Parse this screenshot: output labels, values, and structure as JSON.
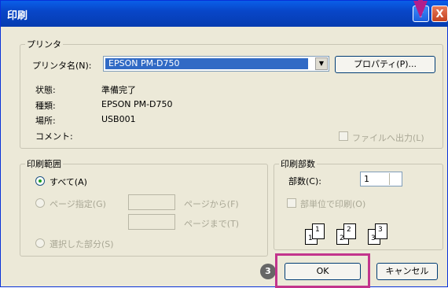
{
  "window": {
    "title": "印刷",
    "help": "?",
    "close": "X"
  },
  "printer": {
    "group_label": "プリンタ",
    "name_label": "プリンタ名(N):",
    "name_value": "EPSON PM-D750",
    "properties_button": "プロパティ(P)...",
    "status_label": "状態:",
    "status_value": "準備完了",
    "type_label": "種類:",
    "type_value": "EPSON PM-D750",
    "location_label": "場所:",
    "location_value": "USB001",
    "comment_label": "コメント:",
    "print_to_file": "ファイルへ出力(L)"
  },
  "range": {
    "group_label": "印刷範囲",
    "all": "すべて(A)",
    "pages": "ページ指定(G)",
    "from": "ページから(F)",
    "to": "ページまで(T)",
    "selection": "選択した部分(S)"
  },
  "copies": {
    "group_label": "印刷部数",
    "count_label": "部数(C):",
    "count_value": "1",
    "collate": "部単位で印刷(O)",
    "collate_pages": [
      "1",
      "1",
      "2",
      "2",
      "3",
      "3"
    ]
  },
  "buttons": {
    "ok": "OK",
    "cancel": "キャンセル"
  },
  "annotation": {
    "step_number": "3"
  }
}
